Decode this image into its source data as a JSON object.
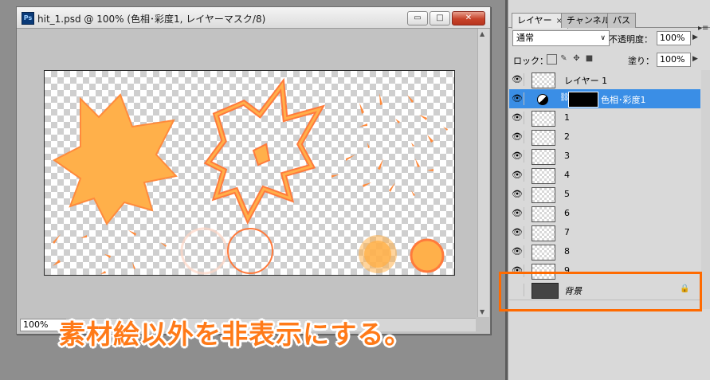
{
  "document": {
    "app_badge": "Ps",
    "title": "hit_1.psd @ 100% (色相･彩度1, レイヤーマスク/8)",
    "zoom": "100%",
    "buttons": {
      "minimize": "▭",
      "maximize": "□",
      "close": "✕"
    }
  },
  "caption": "素材絵以外を非表示にする。",
  "panel": {
    "tabs": [
      {
        "label": "レイヤー",
        "close": "×"
      },
      {
        "label": "チャンネル"
      },
      {
        "label": "パス"
      }
    ],
    "menu_icon": "▸≡",
    "blend_mode": "通常",
    "opacity_label": "不透明度：",
    "opacity_value": "100%",
    "lock_label": "ロック：",
    "fill_label": "塗り：",
    "fill_value": "100%",
    "layers": [
      {
        "name": "レイヤー 1",
        "visible": true,
        "type": "normal"
      },
      {
        "name": "色相･彩度1",
        "visible": true,
        "type": "adjustment",
        "selected": true
      },
      {
        "name": "1",
        "visible": true,
        "type": "normal"
      },
      {
        "name": "2",
        "visible": true,
        "type": "normal"
      },
      {
        "name": "3",
        "visible": true,
        "type": "normal"
      },
      {
        "name": "4",
        "visible": true,
        "type": "normal"
      },
      {
        "name": "5",
        "visible": true,
        "type": "normal"
      },
      {
        "name": "6",
        "visible": true,
        "type": "normal"
      },
      {
        "name": "7",
        "visible": true,
        "type": "normal"
      },
      {
        "name": "8",
        "visible": true,
        "type": "normal"
      },
      {
        "name": "9",
        "visible": true,
        "type": "normal"
      },
      {
        "name": "背景",
        "visible": false,
        "type": "background",
        "locked": true
      }
    ]
  },
  "colors": {
    "accent_orange": "#ff7a18",
    "highlight_box": "#ff6a00",
    "selected_row": "#3a8ee6",
    "art_fill": "#ffb04a",
    "art_stroke": "#ff7a3c"
  }
}
